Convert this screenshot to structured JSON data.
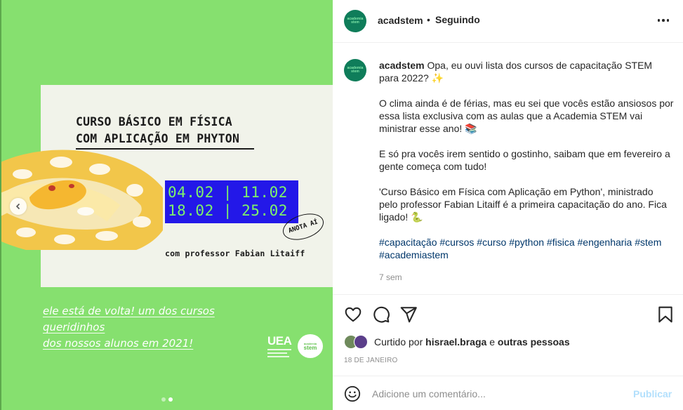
{
  "post": {
    "image": {
      "course_title_lines": [
        "CURSO BÁSICO EM FÍSICA",
        "COM APLICAÇÃO EM PHYTON"
      ],
      "dates_lines": [
        "04.02 | 11.02",
        "18.02 | 25.02"
      ],
      "stamp_text": "ANOTA AÍ",
      "professor_text": "com professor Fabian Litaiff",
      "tagline_lines": [
        "ele está de volta! um dos cursos queridinhos",
        "dos nossos alunos em 2021!"
      ],
      "logo_uea": "UEA",
      "logo_stem_top": "academia",
      "logo_stem_bottom": "stem",
      "carousel_count": 2,
      "carousel_active": 2,
      "background_color": "#86e06f",
      "dates_box_color": "#2318e8"
    },
    "header": {
      "avatar_text_top": "academia",
      "avatar_text_bottom": "stem",
      "username": "acadstem",
      "separator": "•",
      "follow_status": "Seguindo",
      "more_icon": "more-horizontal-icon"
    },
    "caption": {
      "username": "acadstem",
      "paragraph_1": " Opa, eu ouvi lista dos cursos de capacitação STEM para 2022? ✨",
      "paragraph_2": "O clima ainda é de férias, mas eu sei que vocês estão ansiosos por essa lista exclusiva com as aulas que a Academia STEM vai ministrar esse ano! 📚",
      "paragraph_3": "E só pra vocês irem sentido o gostinho, saibam que em fevereiro a gente começa com tudo!",
      "paragraph_4": "'Curso Básico em Física com Aplicação em Python', ministrado pelo professor Fabian Litaiff é a primeira capacitação do ano. Fica ligado! 🐍",
      "hashtags": "#capacitação #cursos #curso #python #fisica #engenharia #stem #academiastem",
      "time_ago": "7 sem"
    },
    "actions": {
      "like_icon": "heart-icon",
      "comment_icon": "comment-icon",
      "share_icon": "send-icon",
      "save_icon": "bookmark-icon"
    },
    "likes": {
      "prefix": "Curtido por",
      "user": "hisrael.braga",
      "conjunction": "e",
      "others": "outras pessoas"
    },
    "date": "18 DE JANEIRO",
    "comment": {
      "placeholder": "Adicione um comentário...",
      "publish_label": "Publicar"
    },
    "colors": {
      "link": "#00376b",
      "publish_disabled": "#b2dffc",
      "muted": "#8e8e8e",
      "avatar_bg": "#0f7d5a"
    }
  }
}
